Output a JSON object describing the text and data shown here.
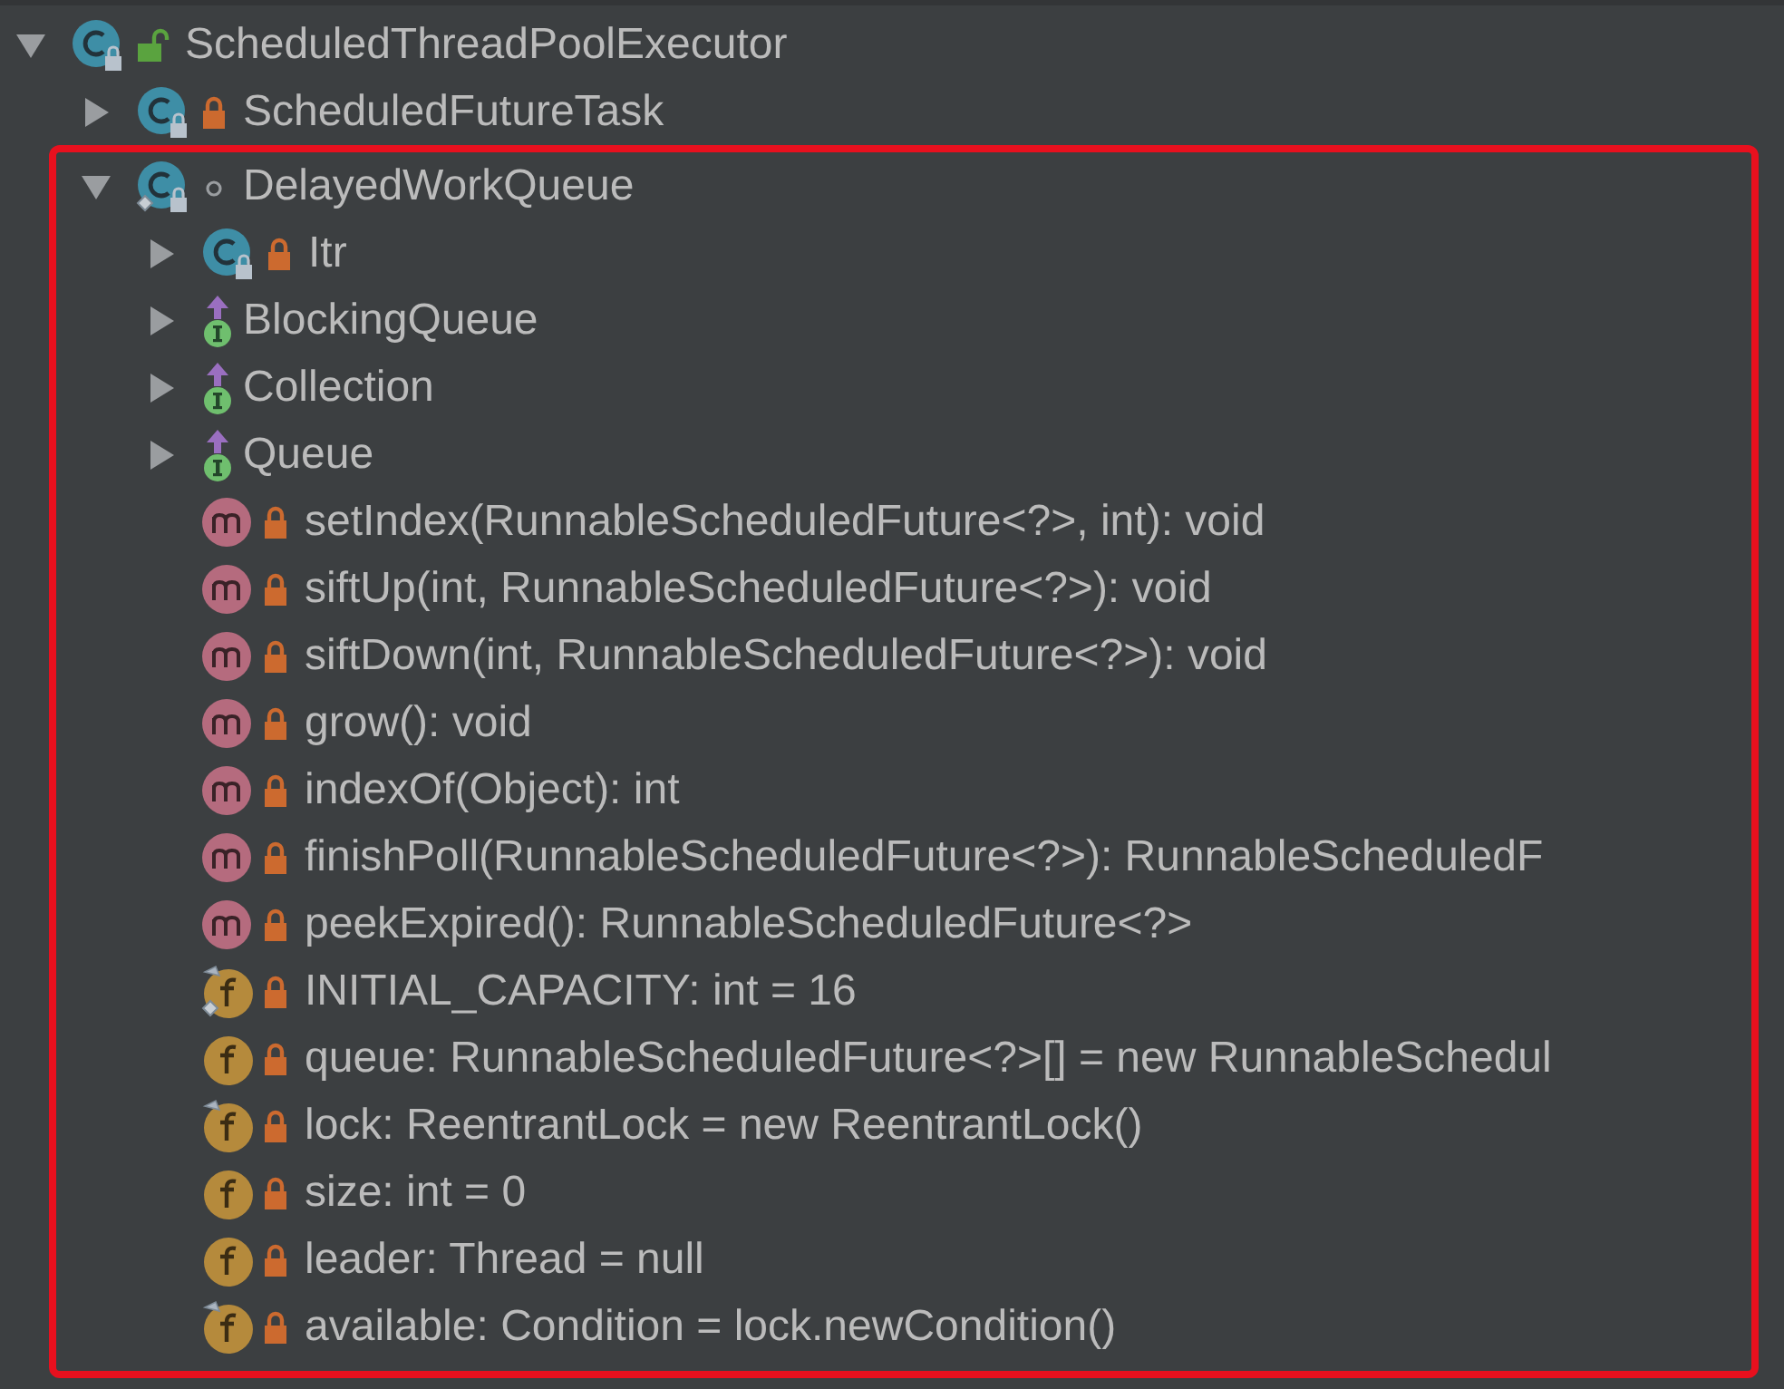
{
  "tree": [
    {
      "label": "ScheduledThreadPoolExecutor",
      "kind": "class",
      "public": true,
      "private": false,
      "expanded": true,
      "static": false,
      "final": false,
      "highlighted": false,
      "children": [
        {
          "label": "ScheduledFutureTask",
          "kind": "class",
          "private": true,
          "expanded": false,
          "static": false,
          "final": false,
          "highlighted": false
        },
        {
          "label": "DelayedWorkQueue",
          "kind": "class",
          "public": false,
          "private": false,
          "expanded": true,
          "static": true,
          "final": false,
          "highlighted": true,
          "children": [
            {
              "label": "Itr",
              "kind": "class",
              "private": true,
              "expanded": false,
              "static": false,
              "final": false,
              "highlighted": false
            },
            {
              "label": "BlockingQueue",
              "kind": "interface",
              "expanded": false
            },
            {
              "label": "Collection",
              "kind": "interface",
              "expanded": false
            },
            {
              "label": "Queue",
              "kind": "interface",
              "expanded": false
            },
            {
              "label": "setIndex(RunnableScheduledFuture<?>, int): void",
              "kind": "method",
              "private": true
            },
            {
              "label": "siftUp(int, RunnableScheduledFuture<?>): void",
              "kind": "method",
              "private": true
            },
            {
              "label": "siftDown(int, RunnableScheduledFuture<?>): void",
              "kind": "method",
              "private": true
            },
            {
              "label": "grow(): void",
              "kind": "method",
              "private": true
            },
            {
              "label": "indexOf(Object): int",
              "kind": "method",
              "private": true
            },
            {
              "label": "finishPoll(RunnableScheduledFuture<?>): RunnableScheduledF",
              "kind": "method",
              "private": true
            },
            {
              "label": "peekExpired(): RunnableScheduledFuture<?>",
              "kind": "method",
              "private": true
            },
            {
              "label": "INITIAL_CAPACITY: int = 16",
              "kind": "field",
              "private": true,
              "static": true,
              "final": true
            },
            {
              "label": "queue: RunnableScheduledFuture<?>[] = new RunnableSchedul",
              "kind": "field",
              "private": true,
              "static": false,
              "final": false
            },
            {
              "label": "lock: ReentrantLock = new ReentrantLock()",
              "kind": "field",
              "private": true,
              "static": false,
              "final": true
            },
            {
              "label": "size: int = 0",
              "kind": "field",
              "private": true,
              "static": false,
              "final": false
            },
            {
              "label": "leader: Thread = null",
              "kind": "field",
              "private": true,
              "static": false,
              "final": false
            },
            {
              "label": "available: Condition = lock.newCondition()",
              "kind": "field",
              "private": true,
              "static": false,
              "final": true
            }
          ]
        }
      ]
    }
  ]
}
